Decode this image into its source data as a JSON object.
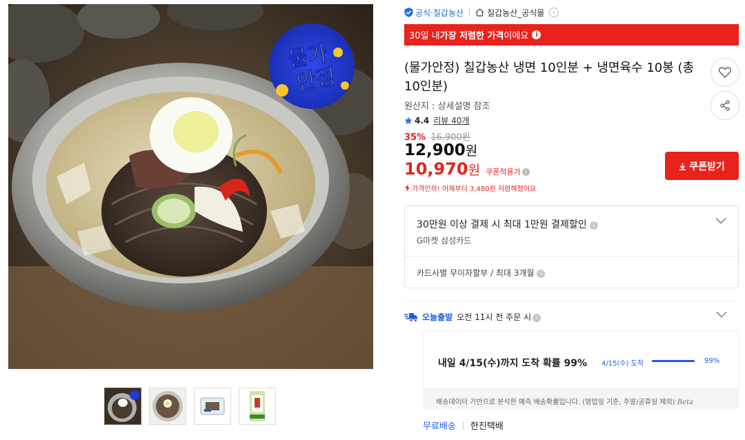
{
  "colors": {
    "accent_red": "#e8231c",
    "accent_blue": "#1f5ce6",
    "official_blue": "#2a6cdf"
  },
  "product_image": {
    "badge_line1": "물가",
    "badge_line2": "안정"
  },
  "thumbnails": [
    {
      "name": "thumb-1",
      "active": true
    },
    {
      "name": "thumb-2",
      "active": false
    },
    {
      "name": "thumb-3",
      "active": false
    },
    {
      "name": "thumb-4",
      "active": false
    }
  ],
  "seller": {
    "official_label": "공식·칠갑농산",
    "store_name": "칠갑농산_공식몰"
  },
  "banner": {
    "prefix": "30일 내 ",
    "highlight": "가장 저렴한 가격",
    "suffix": "이에요"
  },
  "product": {
    "title": "(물가안정) 칠갑농산 냉면 10인분 + 냉면육수 10봉 (총 10인분)",
    "origin": "원산지 : 상세설명 참조",
    "rating": "4.4",
    "reviews": "리뷰 40개",
    "discount_pct": "35%",
    "original_price": "16,900원",
    "price_num": "12,900",
    "price_unit": "원",
    "coupon_price_num": "10,970",
    "coupon_price_unit": "원",
    "coupon_label": "쿠폰적용가",
    "price_drop_note": "가격인하! 어제부터 3,480원 저렴해졌어요"
  },
  "coupon_button": "쿠폰받기",
  "card_benefit": {
    "title": "30만원 이상 결제 시 최대 1만원 결제할인",
    "subtitle": "G마켓 삼성카드",
    "installment": "카드사별 무이자할부 / 최대 3개월"
  },
  "delivery": {
    "today_label": "오늘출발",
    "cutoff_text": "오전 11시 전 주문 시",
    "estimate_title": "내일 4/15(수)까지 도착 확률 99%",
    "estimate_date": "4/15(수) 도착",
    "estimate_pct": "99%",
    "estimate_value": 0.99,
    "note": "배송데이터 기반으로 분석한 예측 배송확률입니다. (영업일 기준, 주말/공휴일 제외)",
    "beta": "Beta",
    "shipping_fee": "무료배송",
    "courier": "한진택배"
  }
}
